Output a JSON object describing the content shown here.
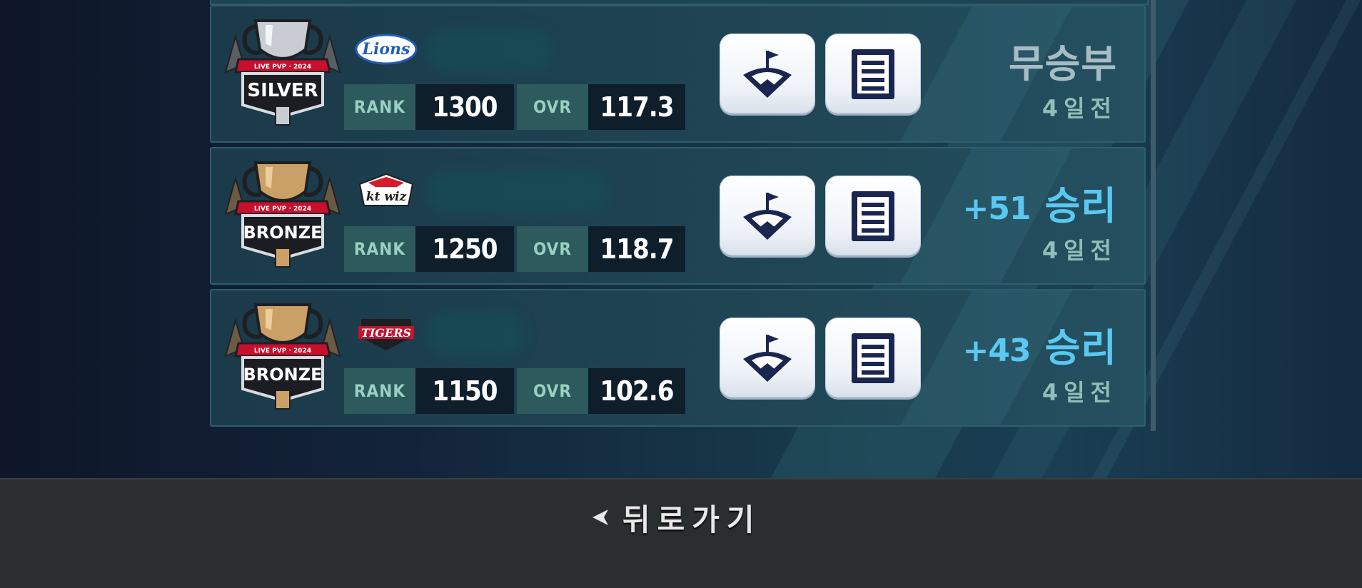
{
  "rows": [
    {
      "tier": "SILVER",
      "emblem_banner": "LIVE PVP · 2024",
      "team_logo": "Lions",
      "team_logo_color": "#1f5fb8",
      "rank_label": "RANK",
      "rank": "1300",
      "ovr_label": "OVR",
      "ovr": "117.3",
      "points": "",
      "result": "무승부",
      "result_type": "draw",
      "ago": "4일전"
    },
    {
      "tier": "BRONZE",
      "emblem_banner": "LIVE PVP · 2024",
      "team_logo": "kt wiz",
      "team_logo_color": "#d61b2d",
      "rank_label": "RANK",
      "rank": "1250",
      "ovr_label": "OVR",
      "ovr": "118.7",
      "points": "+51",
      "result": "승리",
      "result_type": "win",
      "ago": "4일전"
    },
    {
      "tier": "BRONZE",
      "emblem_banner": "LIVE PVP · 2024",
      "team_logo": "TIGERS",
      "team_logo_color": "#c41230",
      "rank_label": "RANK",
      "rank": "1150",
      "ovr_label": "OVR",
      "ovr": "102.6",
      "points": "+43",
      "result": "승리",
      "result_type": "win",
      "ago": "4일전"
    }
  ],
  "footer": {
    "back_label": "뒤로가기",
    "back_icon": "caret-left-icon"
  },
  "colors": {
    "win": "#5ac8f0",
    "draw": "#a7bcc4",
    "silver": "#c9ccd2",
    "bronze": "#caa066"
  }
}
